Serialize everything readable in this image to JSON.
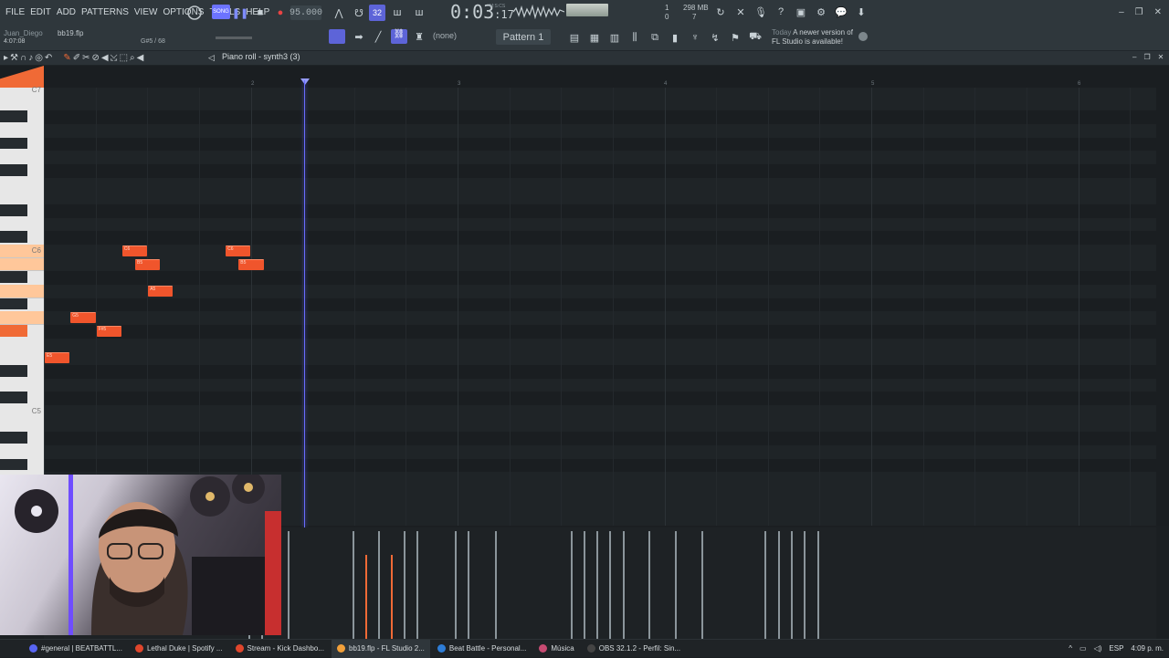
{
  "menu": [
    "FILE",
    "EDIT",
    "ADD",
    "PATTERNS",
    "VIEW",
    "OPTIONS",
    "TOOLS",
    "HELP"
  ],
  "file": {
    "user": "Juan_Diego",
    "name": "bb19.flp",
    "elapsed": "4:07:08",
    "hint": "G#5 / 68"
  },
  "transport": {
    "tempo": "95.000",
    "time_main": "0:03",
    "time_sub": "17",
    "time_label": "M:S:CS",
    "pattern": "Pattern 1",
    "snap": "(none)",
    "pat_num": "32"
  },
  "perf": {
    "memory": "298 MB",
    "voices": "7",
    "cpu_val": "1",
    "cpu_val2": "0"
  },
  "news": {
    "date": "Today",
    "line1": "A newer version of",
    "line2": "FL Studio is available!"
  },
  "pianoroll": {
    "title": "Piano roll - synth3 (3)"
  },
  "keyboard_labels": {
    "top": "C7",
    "c6": "C6",
    "c5": "C5"
  },
  "ruler": [
    "2",
    "3",
    "4",
    "5",
    "6"
  ],
  "notes": [
    {
      "name": "C6",
      "beat_start": 3.0,
      "len": 0.5,
      "pitch": "C6"
    },
    {
      "name": "B5",
      "beat_start": 3.5,
      "len": 0.5,
      "pitch": "B5"
    },
    {
      "name": "A5",
      "beat_start": 4.0,
      "len": 0.5,
      "pitch": "A5"
    },
    {
      "name": "G5",
      "beat_start": 1.0,
      "len": 0.5,
      "pitch": "G5"
    },
    {
      "name": "F#5",
      "beat_start": 2.0,
      "len": 0.5,
      "pitch": "F#5"
    },
    {
      "name": "E5",
      "beat_start": 0.0,
      "len": 0.5,
      "pitch": "E5"
    },
    {
      "name": "C6",
      "beat_start": 7.0,
      "len": 0.5,
      "pitch": "C6"
    },
    {
      "name": "B5",
      "beat_start": 7.5,
      "len": 0.5,
      "pitch": "B5"
    }
  ],
  "taskbar": [
    {
      "label": "#general | BEATBATTL...",
      "color": "#5865f2"
    },
    {
      "label": "Lethal Duke | Spotify ...",
      "color": "#e0462c"
    },
    {
      "label": "Stream - Kick Dashbo...",
      "color": "#e0462c"
    },
    {
      "label": "bb19.flp - FL Studio 2...",
      "color": "#f2a03a"
    },
    {
      "label": "Beat Battle - Personal...",
      "color": "#2e7dd7"
    },
    {
      "label": "Música",
      "color": "#c74b72"
    },
    {
      "label": "OBS 32.1.2 - Perfil: Sin...",
      "color": "#444"
    }
  ],
  "tray": {
    "lang": "ESP",
    "clock": "4:09 p. m."
  }
}
